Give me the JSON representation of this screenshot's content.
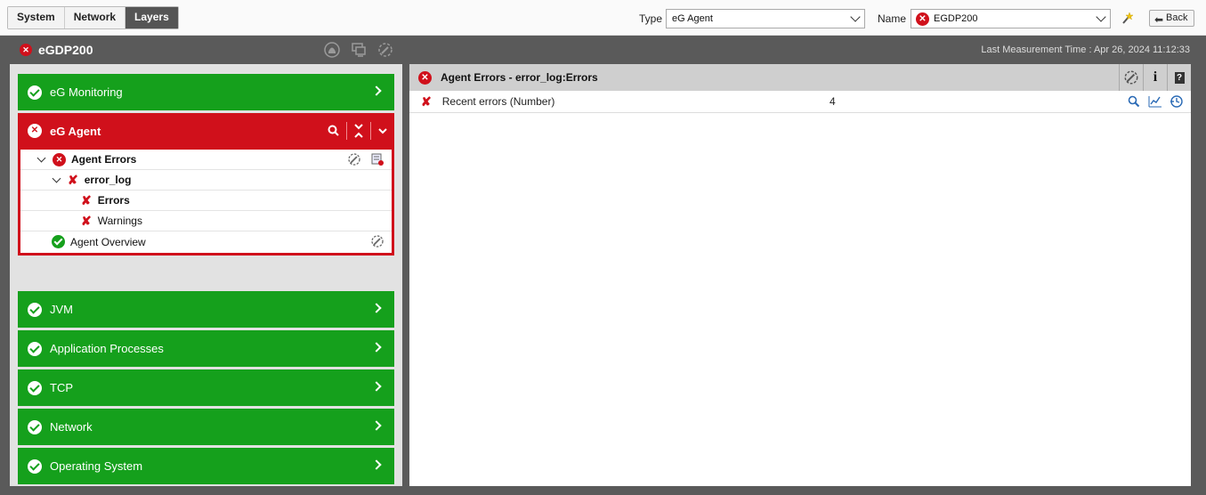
{
  "tabs": [
    {
      "label": "System",
      "active": false
    },
    {
      "label": "Network",
      "active": false
    },
    {
      "label": "Layers",
      "active": true
    }
  ],
  "type_select": {
    "label": "Type",
    "value": "eG Agent"
  },
  "name_select": {
    "label": "Name",
    "value": "EGDP200",
    "status": "error"
  },
  "back_label": "Back",
  "component": {
    "name": "eGDP200",
    "status": "error"
  },
  "last_measurement": "Last Measurement Time : Apr 26, 2024 11:12:33",
  "layers": [
    {
      "label": "eG Monitoring",
      "status": "ok"
    },
    {
      "label": "eG Agent",
      "status": "error",
      "expanded": true
    },
    {
      "label": "JVM",
      "status": "ok"
    },
    {
      "label": "Application Processes",
      "status": "ok"
    },
    {
      "label": "TCP",
      "status": "ok"
    },
    {
      "label": "Network",
      "status": "ok"
    },
    {
      "label": "Operating System",
      "status": "ok"
    }
  ],
  "tree": [
    {
      "label": "Agent Errors",
      "level": 0,
      "status": "error"
    },
    {
      "label": "error_log",
      "level": 1,
      "status": "error"
    },
    {
      "label": "Errors",
      "level": 2,
      "status": "error"
    },
    {
      "label": "Warnings",
      "level": 2,
      "status": "error"
    },
    {
      "label": "Agent Overview",
      "level": 0,
      "status": "ok"
    }
  ],
  "detail": {
    "title": "Agent Errors - error_log:Errors",
    "info_label": "i",
    "help_label": "?",
    "measures": [
      {
        "name": "Recent errors (Number)",
        "value": "4",
        "status": "error"
      }
    ]
  },
  "colors": {
    "ok": "#15a01c",
    "error": "#d0101b",
    "dark": "#5a5a5a"
  }
}
